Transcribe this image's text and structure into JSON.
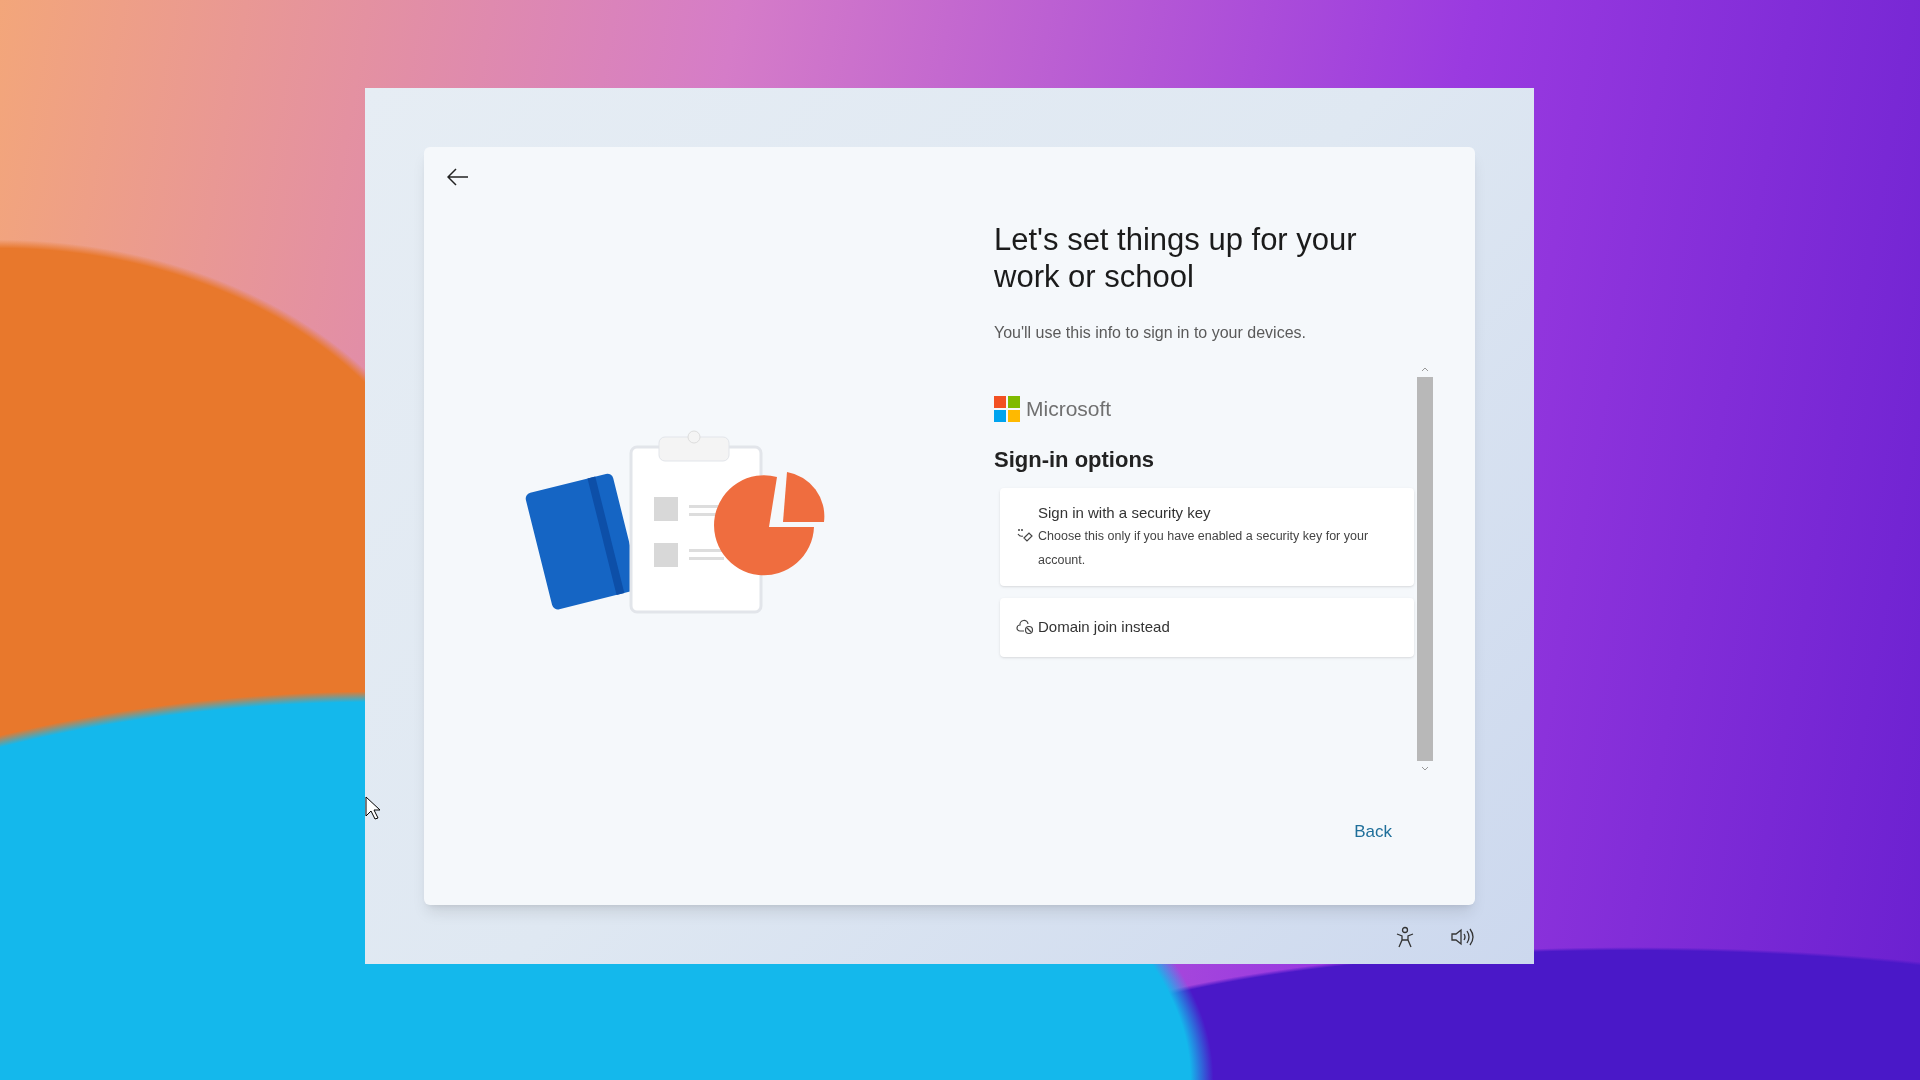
{
  "heading": "Let's set things up for your work or school",
  "subtitle": "You'll use this info to sign in to your devices.",
  "brand": "Microsoft",
  "section_title": "Sign-in options",
  "options": [
    {
      "kind": "security_key",
      "title": "Sign in with a security key",
      "description": "Choose this only if you have enabled a security key for your account."
    },
    {
      "kind": "domain_join",
      "title": "Domain join instead"
    }
  ],
  "back_button": "Back"
}
